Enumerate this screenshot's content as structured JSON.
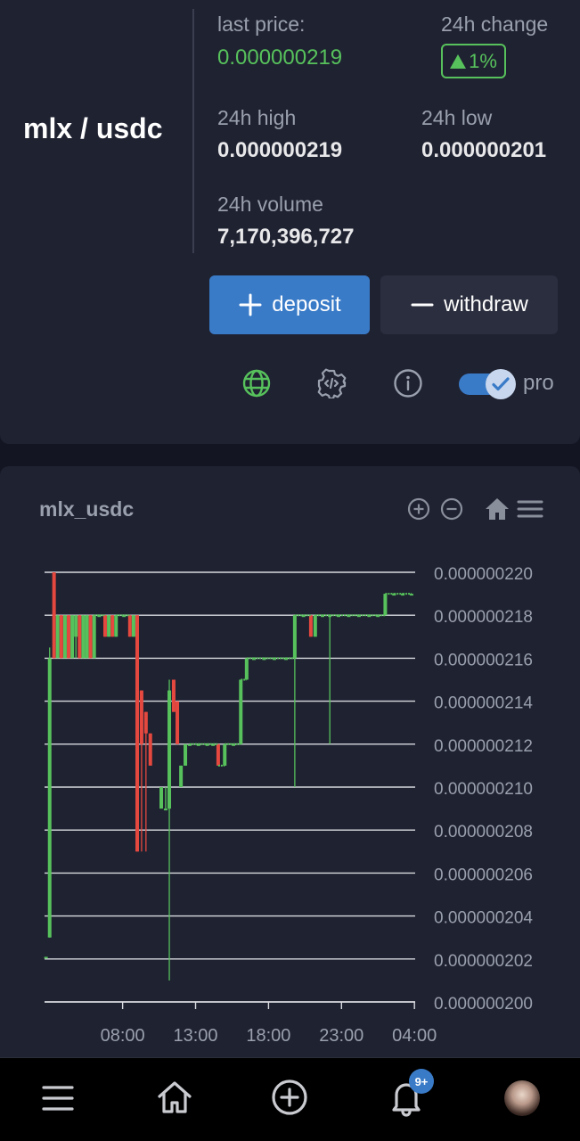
{
  "market": {
    "pair": "mlx / usdc",
    "last_price_label": "last price:",
    "last_price": "0.000000219",
    "change_label": "24h change",
    "change_value": "1%",
    "high_label": "24h high",
    "high_value": "0.000000219",
    "low_label": "24h low",
    "low_value": "0.000000201",
    "volume_label": "24h volume",
    "volume_value": "7,170,396,727"
  },
  "actions": {
    "deposit_label": "deposit",
    "withdraw_label": "withdraw"
  },
  "toolbar": {
    "icons": [
      "globe-icon",
      "settings-code-icon",
      "info-icon"
    ],
    "pro_label": "pro",
    "pro_enabled": true
  },
  "colors": {
    "up": "#57c25c",
    "down": "#e5483f",
    "accent": "#3a7bc8",
    "card_bg": "#1f2231",
    "page_bg": "#131522"
  },
  "chart": {
    "title": "mlx_usdc",
    "tools": [
      "zoom-in-icon",
      "zoom-out-icon",
      "home-icon",
      "menu-icon"
    ]
  },
  "chart_data": {
    "type": "candlestick",
    "grid": true,
    "y_range": [
      2e-07,
      2.2e-07
    ],
    "y_ticks": [
      "0.000000220",
      "0.000000218",
      "0.000000216",
      "0.000000214",
      "0.000000212",
      "0.000000210",
      "0.000000208",
      "0.000000206",
      "0.000000204",
      "0.000000202",
      "0.000000200"
    ],
    "x_ticks": [
      "08:00",
      "13:00",
      "18:00",
      "23:00",
      "04:00"
    ],
    "x_range_hours": [
      2.65,
      28.05
    ],
    "candles": [
      {
        "t": 2.75,
        "o": 202.1,
        "c": 202.1,
        "h": 202.1,
        "l": 202.1
      },
      {
        "t": 3.0,
        "o": 203.0,
        "c": 216.0,
        "h": 216.5,
        "l": 203.0
      },
      {
        "t": 3.3,
        "o": 220.0,
        "c": 216.0,
        "h": 220.0,
        "l": 216.0
      },
      {
        "t": 3.55,
        "o": 216.0,
        "c": 218.0,
        "h": 218.0,
        "l": 216.0
      },
      {
        "t": 3.8,
        "o": 218.0,
        "c": 216.0,
        "h": 218.0,
        "l": 216.0
      },
      {
        "t": 4.05,
        "o": 216.0,
        "c": 218.0,
        "h": 218.0,
        "l": 216.0
      },
      {
        "t": 4.3,
        "o": 218.0,
        "c": 216.0,
        "h": 218.0,
        "l": 216.0
      },
      {
        "t": 4.55,
        "o": 216.0,
        "c": 218.0,
        "h": 218.0,
        "l": 216.0
      },
      {
        "t": 4.8,
        "o": 217.0,
        "c": 218.0,
        "h": 218.0,
        "l": 216.0
      },
      {
        "t": 5.05,
        "o": 218.0,
        "c": 216.0,
        "h": 218.0,
        "l": 216.0
      },
      {
        "t": 5.3,
        "o": 216.0,
        "c": 218.0,
        "h": 218.0,
        "l": 216.0
      },
      {
        "t": 5.55,
        "o": 216.0,
        "c": 218.0,
        "h": 218.0,
        "l": 216.0
      },
      {
        "t": 5.8,
        "o": 218.0,
        "c": 216.0,
        "h": 218.0,
        "l": 216.0
      },
      {
        "t": 6.05,
        "o": 216.0,
        "c": 218.0,
        "h": 218.0,
        "l": 216.0
      },
      {
        "t": 6.4,
        "o": 218.0,
        "c": 218.0,
        "h": 218.0,
        "l": 218.0
      },
      {
        "t": 6.8,
        "o": 218.0,
        "c": 217.0,
        "h": 218.0,
        "l": 217.0
      },
      {
        "t": 7.05,
        "o": 217.0,
        "c": 218.0,
        "h": 218.0,
        "l": 217.0
      },
      {
        "t": 7.3,
        "o": 218.0,
        "c": 217.0,
        "h": 218.0,
        "l": 217.0
      },
      {
        "t": 7.55,
        "o": 217.0,
        "c": 218.0,
        "h": 218.0,
        "l": 217.0
      },
      {
        "t": 8.1,
        "o": 218.0,
        "c": 218.0,
        "h": 218.0,
        "l": 218.0
      },
      {
        "t": 8.5,
        "o": 218.0,
        "c": 217.0,
        "h": 218.0,
        "l": 217.0
      },
      {
        "t": 8.75,
        "o": 217.0,
        "c": 218.0,
        "h": 218.0,
        "l": 217.0
      },
      {
        "t": 9.0,
        "o": 218.0,
        "c": 207.0,
        "h": 218.0,
        "l": 207.0
      },
      {
        "t": 9.3,
        "o": 214.5,
        "c": 212.0,
        "h": 214.5,
        "l": 207.0
      },
      {
        "t": 9.6,
        "o": 213.5,
        "c": 212.5,
        "h": 213.5,
        "l": 207.0
      },
      {
        "t": 9.9,
        "o": 212.5,
        "c": 211.0,
        "h": 212.5,
        "l": 211.0
      },
      {
        "t": 10.65,
        "o": 209.0,
        "c": 210.0,
        "h": 210.0,
        "l": 209.0
      },
      {
        "t": 10.95,
        "o": 209.0,
        "c": 209.0,
        "h": 210.0,
        "l": 209.0
      },
      {
        "t": 11.2,
        "o": 209.0,
        "c": 214.5,
        "h": 215.0,
        "l": 201.0
      },
      {
        "t": 11.5,
        "o": 215.0,
        "c": 213.5,
        "h": 215.0,
        "l": 213.5
      },
      {
        "t": 11.75,
        "o": 214.0,
        "c": 212.0,
        "h": 214.0,
        "l": 212.0
      },
      {
        "t": 12.0,
        "o": 210.0,
        "c": 211.0,
        "h": 211.0,
        "l": 210.0
      },
      {
        "t": 12.3,
        "o": 211.0,
        "c": 212.0,
        "h": 212.0,
        "l": 211.0
      },
      {
        "t": 12.6,
        "o": 212.0,
        "c": 212.0,
        "h": 212.0,
        "l": 212.0
      },
      {
        "t": 13.2,
        "o": 212.0,
        "c": 212.0,
        "h": 212.0,
        "l": 212.0
      },
      {
        "t": 13.8,
        "o": 212.0,
        "c": 212.0,
        "h": 212.0,
        "l": 212.0
      },
      {
        "t": 14.2,
        "o": 212.0,
        "c": 212.0,
        "h": 212.0,
        "l": 212.0
      },
      {
        "t": 14.55,
        "o": 212.0,
        "c": 211.0,
        "h": 212.0,
        "l": 211.0
      },
      {
        "t": 15.0,
        "o": 211.0,
        "c": 212.0,
        "h": 212.0,
        "l": 211.0
      },
      {
        "t": 15.6,
        "o": 212.0,
        "c": 212.0,
        "h": 212.0,
        "l": 212.0
      },
      {
        "t": 16.1,
        "o": 212.0,
        "c": 215.0,
        "h": 215.0,
        "l": 212.0
      },
      {
        "t": 16.5,
        "o": 215.0,
        "c": 216.0,
        "h": 216.0,
        "l": 215.0
      },
      {
        "t": 17.0,
        "o": 216.0,
        "c": 216.0,
        "h": 216.0,
        "l": 216.0
      },
      {
        "t": 17.7,
        "o": 216.0,
        "c": 216.0,
        "h": 216.0,
        "l": 216.0
      },
      {
        "t": 18.4,
        "o": 216.0,
        "c": 216.0,
        "h": 216.0,
        "l": 216.0
      },
      {
        "t": 19.2,
        "o": 216.0,
        "c": 216.0,
        "h": 216.0,
        "l": 216.0
      },
      {
        "t": 19.8,
        "o": 216.0,
        "c": 218.0,
        "h": 218.0,
        "l": 210.0
      },
      {
        "t": 20.4,
        "o": 218.0,
        "c": 218.0,
        "h": 218.0,
        "l": 218.0
      },
      {
        "t": 20.9,
        "o": 218.0,
        "c": 217.0,
        "h": 218.0,
        "l": 217.0
      },
      {
        "t": 21.2,
        "o": 217.0,
        "c": 218.0,
        "h": 218.0,
        "l": 217.0
      },
      {
        "t": 21.7,
        "o": 218.0,
        "c": 218.0,
        "h": 218.0,
        "l": 218.0
      },
      {
        "t": 22.2,
        "o": 218.0,
        "c": 218.0,
        "h": 218.0,
        "l": 212.0
      },
      {
        "t": 22.8,
        "o": 218.0,
        "c": 218.0,
        "h": 218.0,
        "l": 218.0
      },
      {
        "t": 23.5,
        "o": 218.0,
        "c": 218.0,
        "h": 218.0,
        "l": 218.0
      },
      {
        "t": 24.2,
        "o": 218.0,
        "c": 218.0,
        "h": 218.0,
        "l": 218.0
      },
      {
        "t": 24.9,
        "o": 218.0,
        "c": 218.0,
        "h": 218.0,
        "l": 218.0
      },
      {
        "t": 25.5,
        "o": 218.0,
        "c": 218.0,
        "h": 218.0,
        "l": 218.0
      },
      {
        "t": 26.0,
        "o": 218.0,
        "c": 219.0,
        "h": 219.0,
        "l": 218.0
      },
      {
        "t": 26.6,
        "o": 219.0,
        "c": 219.0,
        "h": 219.0,
        "l": 219.0
      },
      {
        "t": 27.2,
        "o": 219.0,
        "c": 219.0,
        "h": 219.0,
        "l": 219.0
      },
      {
        "t": 27.8,
        "o": 219.0,
        "c": 219.0,
        "h": 219.0,
        "l": 219.0
      }
    ],
    "price_unit_note": "1e-9"
  },
  "nav": {
    "items": [
      "menu-icon",
      "home-icon",
      "add-icon",
      "bell-icon",
      "avatar"
    ],
    "notification_badge": "9+"
  }
}
